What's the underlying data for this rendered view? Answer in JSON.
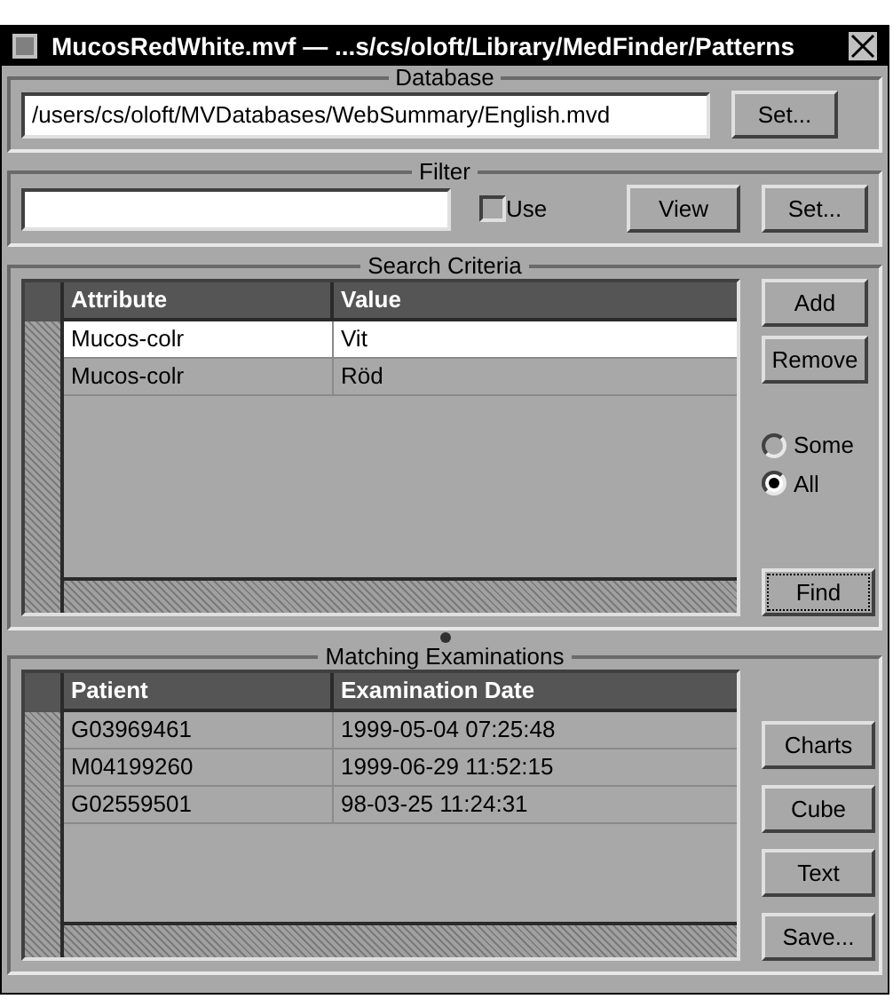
{
  "window": {
    "title": "MucosRedWhite.mvf — ...s/cs/oloft/Library/MedFinder/Patterns"
  },
  "database": {
    "legend": "Database",
    "path": "/users/cs/oloft/MVDatabases/WebSummary/English.mvd",
    "button": "Set..."
  },
  "filter": {
    "legend": "Filter",
    "use_label": "Use",
    "use_checked": false,
    "buttons": [
      "View",
      "Set..."
    ]
  },
  "search_criteria": {
    "legend": "Search Criteria",
    "columns": [
      "Attribute",
      "Value"
    ],
    "rows": [
      {
        "cells": [
          "Mucos-colr",
          "Vit"
        ],
        "selected": true
      },
      {
        "cells": [
          "Mucos-colr",
          "Röd"
        ],
        "selected": false
      }
    ],
    "buttons": [
      {
        "label": "Add",
        "focused": false
      },
      {
        "label": "Remove",
        "focused": false
      }
    ],
    "match": [
      {
        "label": "Some",
        "selected": false
      },
      {
        "label": "All",
        "selected": true
      }
    ],
    "find": {
      "label": "Find",
      "focused": true
    }
  },
  "matching_examinations": {
    "legend": "Matching Examinations",
    "columns": [
      "Patient",
      "Examination Date"
    ],
    "rows": [
      {
        "cells": [
          "G03969461",
          "1999-05-04 07:25:48"
        ],
        "selected": false
      },
      {
        "cells": [
          "M04199260",
          "1999-06-29 11:52:15"
        ],
        "selected": false
      },
      {
        "cells": [
          "G02559501",
          "98-03-25 11:24:31"
        ],
        "selected": false
      }
    ],
    "buttons": [
      "Charts",
      "Cube",
      "Text",
      "Save..."
    ]
  }
}
